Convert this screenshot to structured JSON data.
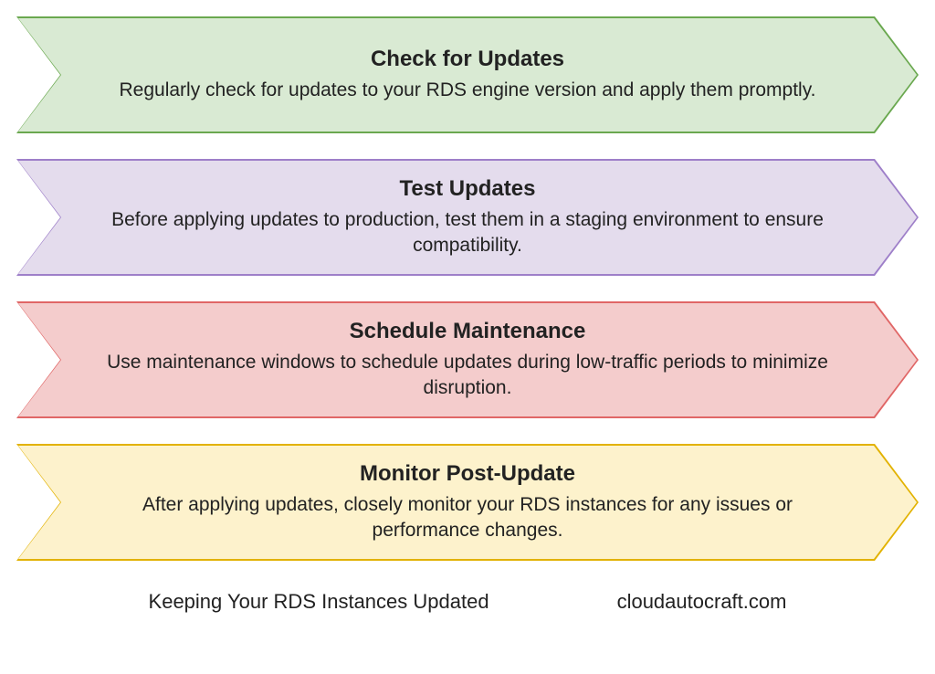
{
  "steps": [
    {
      "title": "Check for Updates",
      "desc": "Regularly check for updates to your RDS engine version and apply them promptly.",
      "back": "green-back",
      "front": "green-front"
    },
    {
      "title": "Test Updates",
      "desc": "Before applying updates to production, test them in a staging environment to ensure compatibility.",
      "back": "purple-back",
      "front": "purple-front"
    },
    {
      "title": "Schedule Maintenance",
      "desc": "Use maintenance windows to schedule updates during low-traffic periods to minimize disruption.",
      "back": "red-back",
      "front": "red-front"
    },
    {
      "title": "Monitor Post-Update",
      "desc": "After applying updates, closely monitor your RDS instances for any issues or performance changes.",
      "back": "yellow-back",
      "front": "yellow-front"
    }
  ],
  "footer": {
    "caption": "Keeping Your RDS Instances Updated",
    "site": "cloudautocraft.com"
  }
}
